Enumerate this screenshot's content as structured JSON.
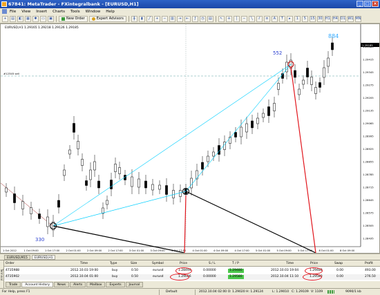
{
  "window": {
    "title": "67841: MetaTrader - FXintegralbank - [EURUSD,H1]",
    "controls": {
      "minimize": "_",
      "maximize": "□",
      "close": "×"
    }
  },
  "menu": [
    "File",
    "View",
    "Insert",
    "Charts",
    "Tools",
    "Window",
    "Help"
  ],
  "toolbar": {
    "new_order_label": "New Order",
    "expert_advisors_label": "Expert Advisors"
  },
  "chart": {
    "info": "EURUSD,H1  1.29165  1.29218  1.29126  1.29185",
    "level_label": "#12345  sell",
    "annotations": {
      "a": "330",
      "b": "552",
      "c": "884"
    },
    "price_labels": [
      "1.29485",
      "1.29415",
      "1.29345",
      "1.29275",
      "1.29205",
      "1.29135",
      "1.29065",
      "1.28995",
      "1.28925",
      "1.28855",
      "1.28785",
      "1.28715",
      "1.28645",
      "1.28575",
      "1.28505",
      "1.28435"
    ],
    "current_price": "1.29185",
    "time_labels": [
      "1 Oct 2012",
      "1 Oct 09:00",
      "1 Oct 17:00",
      "2 Oct 01:00",
      "2 Oct 09:00",
      "2 Oct 17:00",
      "3 Oct 01:00",
      "3 Oct 09:00",
      "3 Oct 17:00",
      "4 Oct 01:00",
      "4 Oct 09:00",
      "4 Oct 17:00",
      "5 Oct 01:00",
      "5 Oct 09:00",
      "5 Oct 17:00",
      "8 Oct 01:00",
      "8 Oct 09:00"
    ],
    "colors": {
      "candle": "#000000",
      "trendline": "#00cfff",
      "arrow_black": "#000000",
      "arrow_red": "#e1151c",
      "annotation": "#2a3fd0",
      "annotation_c": "#33aaff",
      "level": "#5aa5a5"
    }
  },
  "chart_tabs": [
    "EURUSD,M15",
    "EURUSD,H1"
  ],
  "terminal": {
    "side_label": "Terminal",
    "columns": [
      "Order",
      "Time",
      "Type",
      "Size",
      "Symbol",
      "Price",
      "S / L",
      "T / P",
      "Time",
      "Price",
      "Swap",
      "Profit"
    ],
    "rows": [
      {
        "order": "4735988",
        "time": "2012.10.03 19:00",
        "type": "buy",
        "size": "0.50",
        "symbol": "eurusd",
        "price": "1.28494",
        "sl": "0.00000",
        "tp": "1.29480",
        "close_time": "2012.10.03 19:04",
        "close_price": "1.29480",
        "swap": "0.00",
        "profit": "493.00"
      },
      {
        "order": "4735902",
        "time": "2012.10.04 01:00",
        "type": "buy",
        "size": "0.50",
        "symbol": "eurusd",
        "price": "1.29026",
        "sl": "0.00000",
        "tp": "1.29580",
        "close_time": "2012.10.04 11:10",
        "close_price": "1.29580",
        "swap": "0.00",
        "profit": "276.50"
      }
    ],
    "tabs": [
      "Trade",
      "Account History",
      "News",
      "Alerts",
      "Mailbox",
      "Experts",
      "Journal"
    ]
  },
  "statusbar": {
    "help": "For Help, press F1",
    "profile": "Default",
    "bar_info": "2012.10.04 02:00  O: 1.29020  H: 1.29124",
    "low": "L: 1.29010",
    "close": "C: 1.29109",
    "volume": "V: 1109",
    "traffic": "9090/1 kb"
  }
}
